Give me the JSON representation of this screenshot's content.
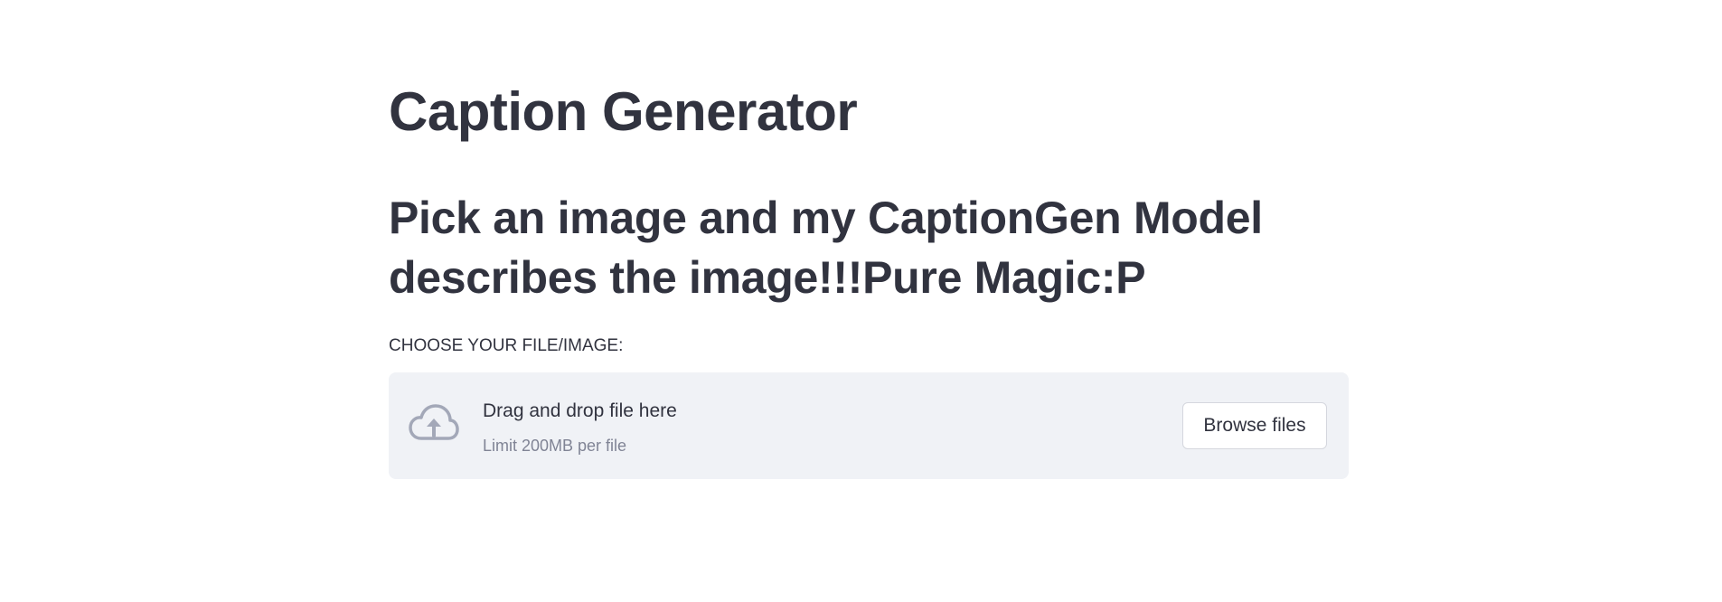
{
  "page": {
    "title": "Caption Generator",
    "subtitle": "Pick an image and my CaptionGen Model describes the image!!!Pure Magic:P"
  },
  "uploader": {
    "label": "CHOOSE YOUR FILE/IMAGE:",
    "drop_text": "Drag and drop file here",
    "limit_text": "Limit 200MB per file",
    "browse_label": "Browse files",
    "icon": "cloud-upload-icon"
  },
  "colors": {
    "text": "#31333f",
    "muted_text": "#808495",
    "dropzone_bg": "#f0f2f6",
    "icon": "#a3a8b8",
    "button_border": "#d5d7de"
  }
}
